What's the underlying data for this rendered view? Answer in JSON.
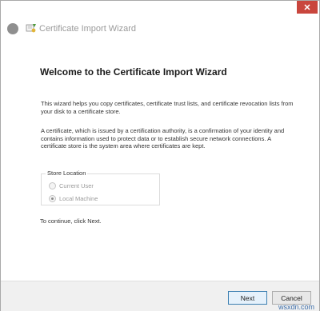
{
  "window": {
    "close_glyph": "✕"
  },
  "header": {
    "title": "Certificate Import Wizard",
    "icon": "certificate-wizard-icon"
  },
  "content": {
    "heading": "Welcome to the Certificate Import Wizard",
    "paragraph1": "This wizard helps you copy certificates, certificate trust lists, and certificate revocation lists from your disk to a certificate store.",
    "paragraph2": "A certificate, which is issued by a certification authority, is a confirmation of your identity and contains information used to protect data or to establish secure network connections. A certificate store is the system area where certificates are kept.",
    "store_location": {
      "legend": "Store Location",
      "options": [
        {
          "label": "Current User",
          "checked": false,
          "disabled": true
        },
        {
          "label": "Local Machine",
          "checked": true,
          "disabled": true
        }
      ]
    },
    "continue_text": "To continue, click Next."
  },
  "footer": {
    "next_label": "Next",
    "cancel_label": "Cancel"
  },
  "watermark": "wsxdn.com"
}
